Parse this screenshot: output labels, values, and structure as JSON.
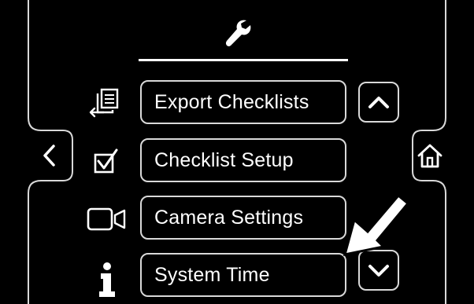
{
  "menu": {
    "items": [
      {
        "label": "Export Checklists",
        "icon": "export-icon"
      },
      {
        "label": "Checklist Setup",
        "icon": "checkbox-icon"
      },
      {
        "label": "Camera Settings",
        "icon": "camera-icon"
      },
      {
        "label": "System Time",
        "icon": "info-icon"
      }
    ]
  },
  "header": {
    "icon": "wrench-icon"
  },
  "nav": {
    "back_icon": "chevron-left-icon",
    "home_icon": "home-icon",
    "scroll_up_icon": "chevron-up-icon",
    "scroll_down_icon": "chevron-down-icon"
  },
  "annotation": {
    "icon": "pointer-arrow-icon"
  },
  "colors": {
    "background": "#000000",
    "foreground": "#ffffff",
    "outline": "#d9d9d9"
  }
}
